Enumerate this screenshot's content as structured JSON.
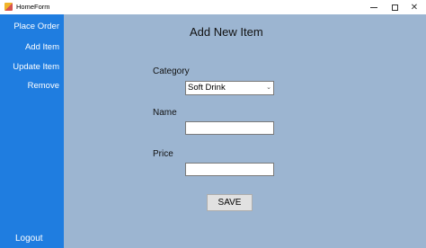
{
  "window": {
    "title": "HomeForm",
    "close_glyph": "✕"
  },
  "sidebar": {
    "items": [
      {
        "label": "Place Order"
      },
      {
        "label": "Add Item"
      },
      {
        "label": "Update Item"
      },
      {
        "label": "Remove"
      }
    ],
    "logout_label": "Logout"
  },
  "form": {
    "title": "Add New Item",
    "category_label": "Category",
    "category_value": "Soft Drink",
    "chevron_glyph": "⌄",
    "name_label": "Name",
    "name_value": "",
    "price_label": "Price",
    "price_value": "",
    "save_label": "SAVE"
  },
  "colors": {
    "sidebar": "#1f7de0",
    "main_background": "#9cb5d1",
    "button": "#e1e1e1"
  }
}
